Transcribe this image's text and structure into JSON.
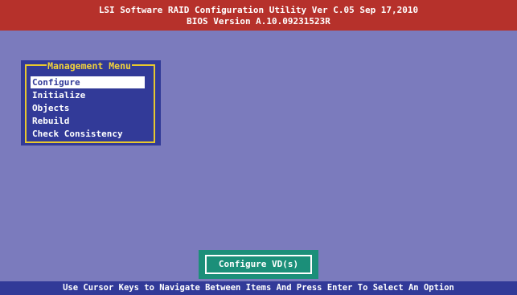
{
  "header": {
    "title": "LSI Software RAID Configuration Utility Ver C.05 Sep 17,2010",
    "bios": "BIOS Version  A.10.09231523R"
  },
  "menu": {
    "title": "Management Menu",
    "items": [
      {
        "label": "Configure",
        "selected": true
      },
      {
        "label": "Initialize",
        "selected": false
      },
      {
        "label": "Objects",
        "selected": false
      },
      {
        "label": "Rebuild",
        "selected": false
      },
      {
        "label": "Check Consistency",
        "selected": false
      }
    ]
  },
  "submenu_hint": "Configure VD(s)",
  "status_bar": "Use Cursor Keys to Navigate Between Items And Press Enter To Select An Option",
  "colors": {
    "background": "#7b7bbd",
    "header": "#b6312b",
    "menu_panel": "#323a98",
    "menu_border": "#e8c82e",
    "hint_box": "#1b8f79",
    "status_bar": "#323a98"
  }
}
